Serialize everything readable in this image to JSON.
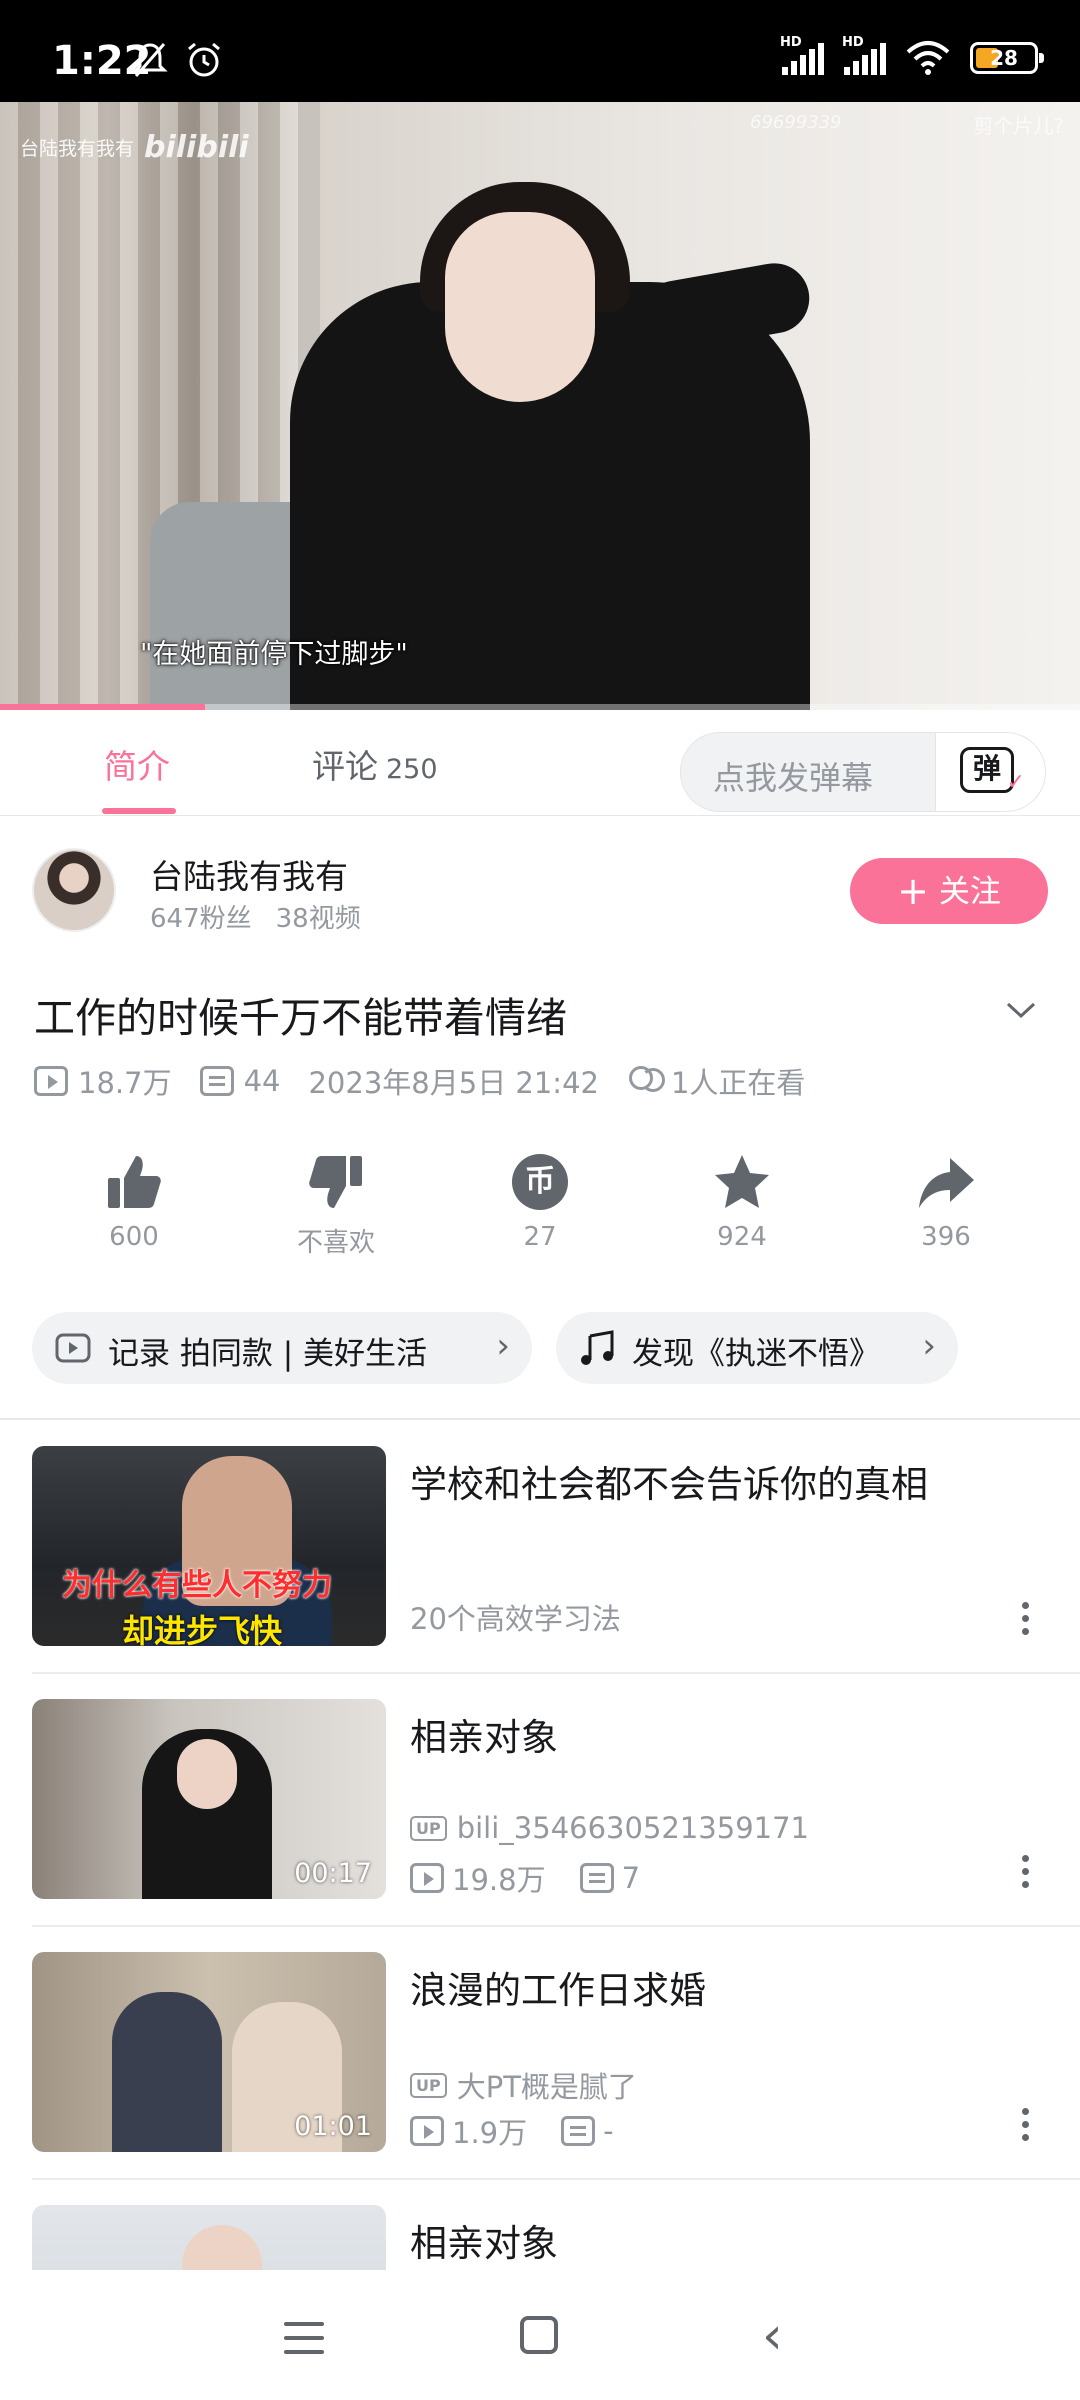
{
  "status_bar": {
    "time": "1:22",
    "battery": "28",
    "signal_labels": [
      "HD",
      "HD"
    ]
  },
  "video": {
    "watermark_channel": "台陆我有我有",
    "watermark_brand": "bilibili",
    "watermark_id": "69699339",
    "watermark_right": "剪个片儿?",
    "subtitle": "\"在她面前停下过脚步\"",
    "progress_fraction": 0.19
  },
  "tabs": {
    "intro": "简介",
    "comments": "评论",
    "comments_count": "250",
    "danmaku_placeholder": "点我发弹幕",
    "danmaku_icon_char": "弹"
  },
  "uploader": {
    "name": "台陆我有我有",
    "fans": "647粉丝",
    "videos": "38视频",
    "follow_label": "关注"
  },
  "video_info": {
    "title": "工作的时候千万不能带着情绪",
    "views": "18.7万",
    "danmaku_count": "44",
    "date": "2023年8月5日 21:42",
    "watching": "1人正在看"
  },
  "actions": {
    "like": "600",
    "dislike": "不喜欢",
    "coin": "27",
    "coin_icon_char": "币",
    "favorite": "924",
    "share": "396"
  },
  "chips": [
    {
      "label": "记录   拍同款 | 美好生活"
    },
    {
      "label": "发现《执迷不悟》"
    }
  ],
  "related": [
    {
      "title": "学校和社会都不会告诉你的真相",
      "subtitle": "20个高效学习法",
      "caption_top": "为什么有些人不努力",
      "caption_bottom": "却进步飞快"
    },
    {
      "title": "相亲对象",
      "owner": "bili_3546630521359171",
      "views": "19.8万",
      "danmaku": "7",
      "duration": "00:17"
    },
    {
      "title": "浪漫的工作日求婚",
      "owner": "大PT概是腻了",
      "views": "1.9万",
      "danmaku": "-",
      "duration": "01:01"
    },
    {
      "title": "相亲对象"
    }
  ],
  "up_badge": "UP",
  "colors": {
    "accent": "#fb7299",
    "text": "#18191c",
    "muted": "#9499a0"
  }
}
